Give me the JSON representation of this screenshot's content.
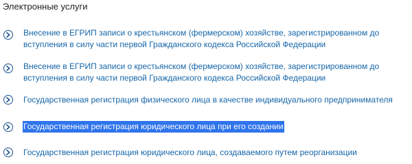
{
  "section": {
    "title": "Электронные услуги"
  },
  "services": [
    {
      "label": "Внесение в ЕГРИП записи о крестьянском (фермерском) хозяйстве, зарегистрированном до вступления в силу части первой Гражданского кодекса Российской Федерации",
      "icon": "chevron-right-circle-icon"
    },
    {
      "label": "Внесение в ЕГРИП записи о крестьянском (фермерском) хозяйстве, зарегистрированном до вступления в силу части первой Гражданского кодекса Российской Федерации",
      "icon": "chevron-right-circle-icon"
    },
    {
      "label": "Государственная регистрация физического лица в качестве индивидуального предпринимателя",
      "icon": "chevron-right-circle-icon"
    },
    {
      "label": "Государственная регистрация юридического лица при его создании",
      "icon": "chevron-right-circle-icon",
      "selected": true
    },
    {
      "label": "Государственная регистрация юридического лица, создаваемого путем реорганизации",
      "icon": "chevron-right-circle-icon"
    }
  ],
  "colors": {
    "link": "#1565a8",
    "icon": "#1a4f8c",
    "selection_bg": "#2f74ec",
    "selection_text": "#ffffff",
    "title": "#222222"
  }
}
